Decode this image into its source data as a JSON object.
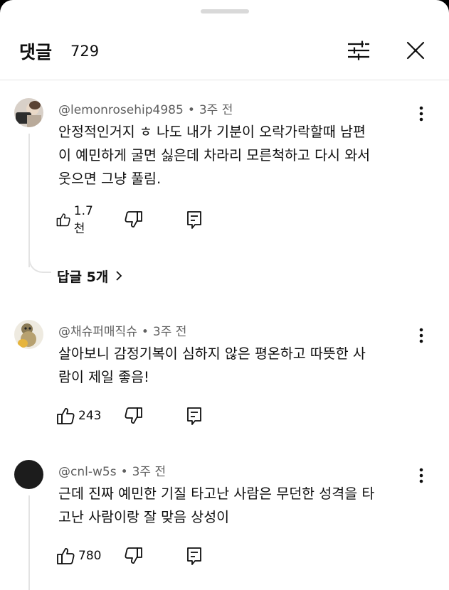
{
  "header": {
    "title": "댓글",
    "count": "729"
  },
  "comments": [
    {
      "author": "@lemonrosehip4985",
      "time": "3주 전",
      "lines": [
        "안정적인거지 ㅎ 나도 내가 기분이 오락가락할때 남편",
        "이 예민하게 굴면 싫은데 차라리 모른척하고 다시 와서",
        "웃으면 그냥 풀림."
      ],
      "likes": "1.7천",
      "replies": "답글 5개"
    },
    {
      "author": "@채슈퍼매직슈",
      "time": "3주 전",
      "lines": [
        "살아보니 감정기복이 심하지 않은 평온하고 따뜻한 사",
        "람이 제일 좋음!"
      ],
      "likes": "243"
    },
    {
      "author": "@cnl-w5s",
      "time": "3주 전",
      "lines": [
        "근데 진짜 예민한 기질 타고난 사람은 무던한 성격을 타",
        "고난 사람이랑 잘 맞음 상성이"
      ],
      "likes": "780"
    }
  ],
  "icons": {
    "filter": "filter-icon",
    "close": "close-icon",
    "more": "more-vert-icon",
    "like": "thumb-up-icon",
    "dislike": "thumb-down-icon",
    "reply": "reply-icon",
    "chevron": "chevron-right-icon"
  }
}
